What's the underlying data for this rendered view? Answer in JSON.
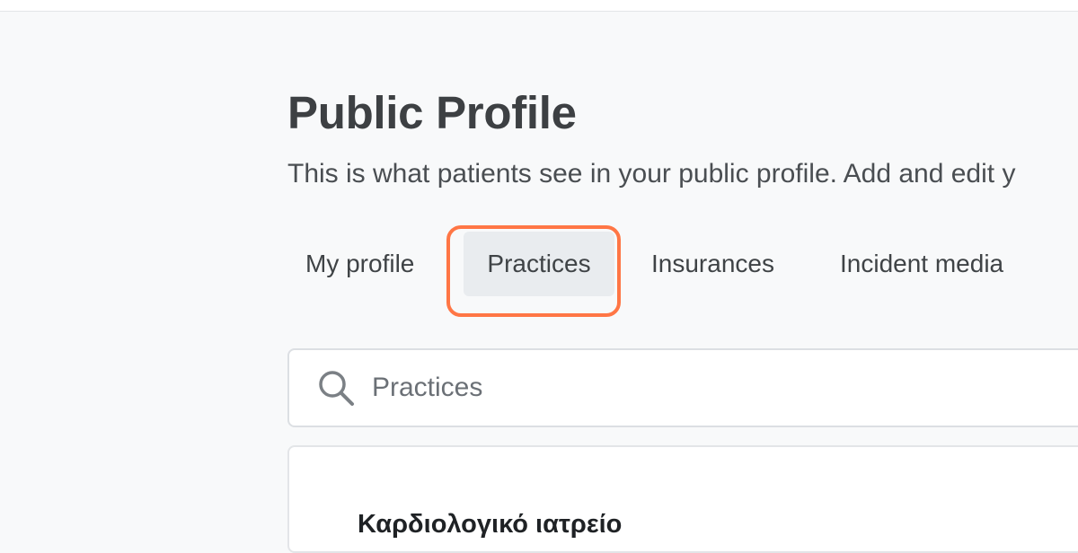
{
  "page": {
    "title": "Public Profile",
    "subtitle": "This is what patients see in your public profile. Add and edit y"
  },
  "tabs": [
    {
      "label": "My profile",
      "selected": false
    },
    {
      "label": "Practices",
      "selected": true
    },
    {
      "label": "Insurances",
      "selected": false
    },
    {
      "label": "Incident media",
      "selected": false
    }
  ],
  "search": {
    "value": "",
    "placeholder": "Practices",
    "icon": "search-icon"
  },
  "practices": [
    {
      "name": "Καρδιολογικό ιατρείο"
    }
  ],
  "colors": {
    "highlight": "#ff7645",
    "selected_tab_bg": "#e9ecef",
    "page_bg": "#f8f9fa"
  }
}
